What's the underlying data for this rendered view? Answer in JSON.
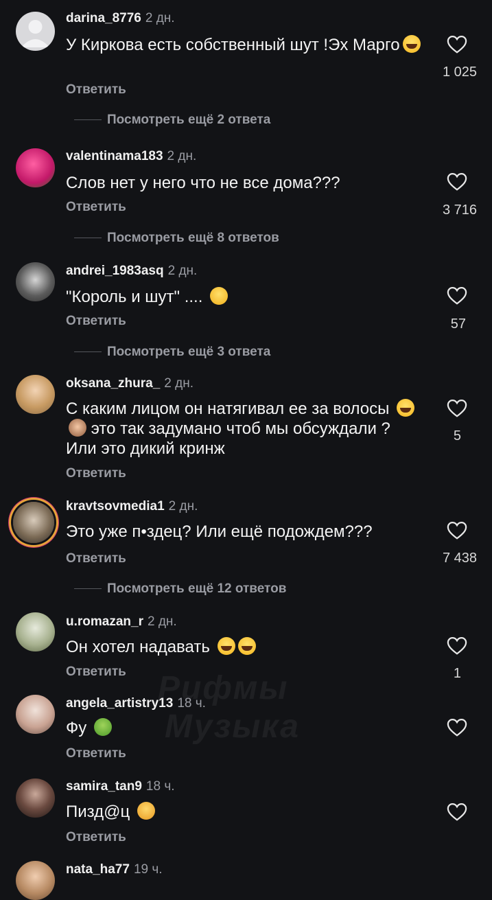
{
  "reply_label": "Ответить",
  "comments": [
    {
      "user": "darina_8776",
      "time": "2 дн.",
      "text": "У Киркова есть собственный шут !Эх Марго",
      "likes": "1 025",
      "more": "Посмотреть ещё 2 ответа"
    },
    {
      "user": "valentinama183",
      "time": "2 дн.",
      "text": "Слов нет у него что не все дома???",
      "likes": "3 716",
      "more": "Посмотреть ещё 8 ответов"
    },
    {
      "user": "andrei_1983asq",
      "time": "2 дн.",
      "text": "\"Король и шут\" ....",
      "likes": "57",
      "more": "Посмотреть ещё 3 ответа"
    },
    {
      "user": "oksana_zhura_",
      "time": "2 дн.",
      "text_a": "С каким лицом он натягивал ее за волосы",
      "text_b": "это так задумано чтоб мы обсуждали ? Или это дикий кринж",
      "likes": "5"
    },
    {
      "user": "kravtsovmedia1",
      "time": "2 дн.",
      "text": "Это уже п•здец? Или ещё подождем???",
      "likes": "7 438",
      "more": "Посмотреть ещё 12 ответов"
    },
    {
      "user": "u.romazan_r",
      "time": "2 дн.",
      "text": "Он хотел надавать",
      "likes": "1"
    },
    {
      "user": "angela_artistry13",
      "time": "18 ч.",
      "text": "Фу"
    },
    {
      "user": "samira_tan9",
      "time": "18 ч.",
      "text": "Пизд@ц"
    },
    {
      "user": "nata_ha77",
      "time": "19 ч."
    }
  ],
  "watermark": {
    "line1": "Рифмы",
    "line2": "Музыка"
  },
  "icons": {
    "like": "heart-outline-icon"
  },
  "colors": {
    "background": "#121316",
    "secondary_text": "#9a9ca3"
  }
}
